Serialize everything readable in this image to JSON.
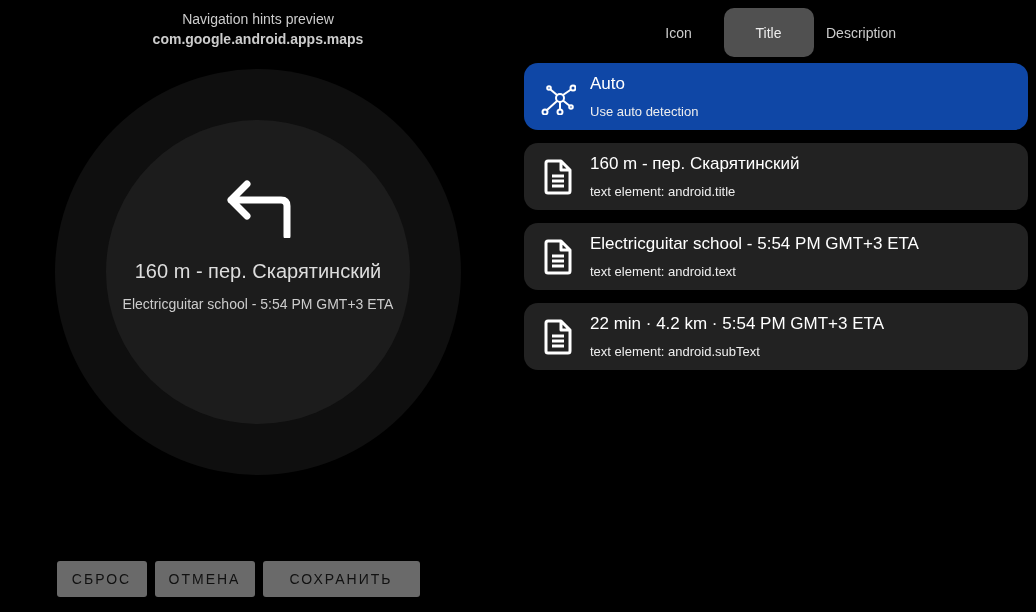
{
  "preview": {
    "title": "Navigation hints preview",
    "package": "com.google.android.apps.maps",
    "hint_title": "160 m - пер. Скарятинский",
    "hint_text": "Electricguitar school - 5:54 PM GMT+3 ETA"
  },
  "buttons": [
    {
      "label": "СБРОС"
    },
    {
      "label": "ОТМЕНА"
    },
    {
      "label": "СОХРАНИТЬ"
    }
  ],
  "tabs": [
    {
      "label": "Icon",
      "selected": false
    },
    {
      "label": "Title",
      "selected": true
    },
    {
      "label": "Description",
      "selected": false
    }
  ],
  "options": [
    {
      "kind": "auto",
      "title": "Auto",
      "subtitle": "Use auto detection",
      "selected": true
    },
    {
      "kind": "text",
      "title": "160 m - пер. Скарятинский",
      "subtitle": "text element: android.title",
      "selected": false
    },
    {
      "kind": "text",
      "title": "Electricguitar school - 5:54 PM GMT+3 ETA",
      "subtitle": "text element: android.text",
      "selected": false
    },
    {
      "kind": "text",
      "title": "22 min · 4.2 km · 5:54 PM GMT+3 ETA",
      "subtitle": "text element: android.subText",
      "selected": false
    }
  ]
}
